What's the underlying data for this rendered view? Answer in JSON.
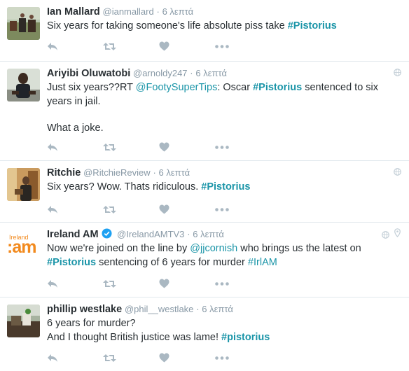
{
  "colors": {
    "accent": "#1b95a8",
    "meta": "#8899a6",
    "text": "#292f33",
    "divider": "#e1e8ed",
    "icon": "#aab8c2"
  },
  "icons": [
    "reply-icon",
    "retweet-icon",
    "like-icon",
    "more-icon",
    "globe-icon",
    "location-pin-icon",
    "verified-badge-icon"
  ],
  "tweets": [
    {
      "name": "Ian Mallard",
      "handle": "@ianmallard",
      "time": "6 λεπτά",
      "text": {
        "t0": "Six years for taking someone's life absolute piss take ",
        "h0": "#Pistorius"
      }
    },
    {
      "name": "Ariyibi Oluwatobi",
      "handle": "@arnoldy247",
      "time": "6 λεπτά",
      "text": {
        "t0": "Just six years??RT ",
        "m0": "@FootySuperTips",
        "t1": ": Oscar ",
        "h0": "#Pistorius",
        "t2": " sentenced to six years in jail.",
        "t3": "What a joke."
      }
    },
    {
      "name": "Ritchie",
      "handle": "@RitchieReview",
      "time": "6 λεπτά",
      "text": {
        "t0": "Six years? Wow. Thats ridiculous. ",
        "h0": "#Pistorius"
      }
    },
    {
      "name": "Ireland AM",
      "handle": "@IrelandAMTV3",
      "time": "6 λεπτά",
      "logo_top": "Ireland",
      "logo_main": ":am",
      "text": {
        "t0": "Now we're joined on the line by ",
        "m0": "@jjcornish",
        "t1": " who brings us the latest on ",
        "h0": "#Pistorius",
        "t2": " sentencing of 6 years for murder ",
        "h1": "#IrlAM"
      }
    },
    {
      "name": "phillip westlake",
      "handle": "@phil__westlake",
      "time": "6 λεπτά",
      "text": {
        "t0": "6 years for murder?",
        "t1": "And I thought British justice was lame! ",
        "h0": "#pistorius"
      }
    }
  ]
}
